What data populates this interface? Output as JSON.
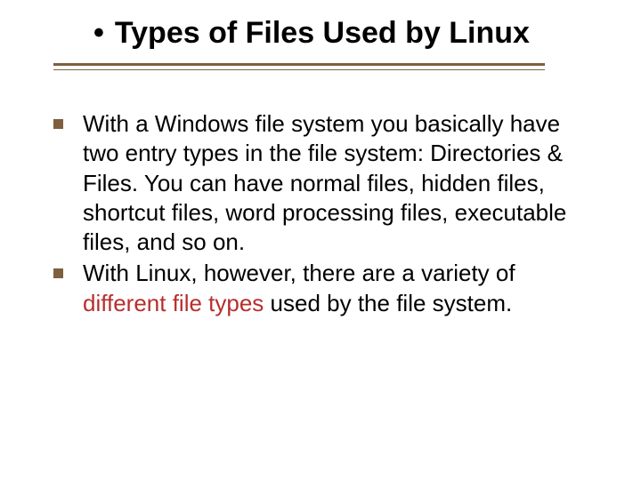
{
  "title": {
    "bullet": "•",
    "text": "Types of Files Used by Linux"
  },
  "body": {
    "items": [
      {
        "text_before": "With a Windows file system you basically have two entry types in the file system: Directories & Files. You can have normal files, hidden files, shortcut files, word processing files, executable files, and so on.",
        "highlight": "",
        "text_after": ""
      },
      {
        "text_before": "With Linux, however, there are a variety of ",
        "highlight": "different file types",
        "text_after": " used by the file system."
      }
    ]
  }
}
